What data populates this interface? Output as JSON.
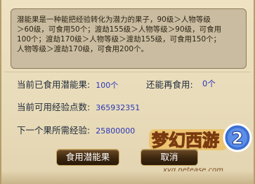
{
  "description": {
    "lines": [
      "潜能果是一种能把经验转化为潜力的果子，90级＞人物等级",
      "＞60级，可食用50个；渡劫155级＞人物等级＞90级，可食用",
      "100个；渡劫170级＞人物等级＞渡劫155级，可食用150个；",
      "人物等级＞渡劫170级，可食用200个。"
    ]
  },
  "stats": {
    "eaten_label": "当前已食用潜能果:",
    "eaten_value": "100个",
    "remaining_label": "还能再食用:",
    "remaining_value": "0个",
    "available_exp_label": "当前可用经验点数:",
    "available_exp_value": "365932351",
    "next_cost_label": "下一个果所需经验:",
    "next_cost_value": "25800000"
  },
  "buttons": {
    "eat_label": "食用潜能果",
    "cancel_label": "取消"
  },
  "logo": {
    "title": "梦幻西游",
    "number": "2",
    "site": "xyq.netease.com"
  },
  "colors": {
    "value_text": "#2b36b8",
    "panel_bg": "#e8dbb9",
    "desc_bg": "#c9bca0",
    "button_bg": "#3c2610"
  }
}
